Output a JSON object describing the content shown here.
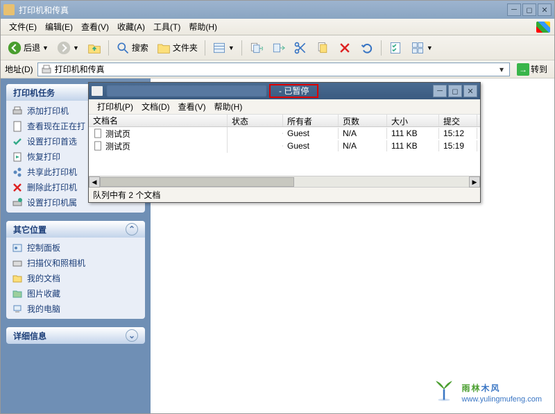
{
  "window": {
    "title": "打印机和传真"
  },
  "menu": {
    "file": "文件(E)",
    "edit": "编辑(E)",
    "view": "查看(V)",
    "favorites": "收藏(A)",
    "tools": "工具(T)",
    "help": "帮助(H)"
  },
  "toolbar": {
    "back": "后退",
    "search": "搜索",
    "folders": "文件夹"
  },
  "address": {
    "label": "地址(D)",
    "value": "打印机和传真",
    "go": "转到"
  },
  "sidebar": {
    "tasks": {
      "title": "打印机任务",
      "items": [
        "添加打印机",
        "查看现在正在打",
        "设置打印首选",
        "恢复打印",
        "共享此打印机",
        "删除此打印机",
        "设置打印机属"
      ]
    },
    "other": {
      "title": "其它位置",
      "items": [
        "控制面板",
        "扫描仪和照相机",
        "我的文档",
        "图片收藏",
        "我的电脑"
      ]
    },
    "details": {
      "title": "详细信息"
    }
  },
  "queue_window": {
    "title_status": "- 已暂停",
    "menu": {
      "printer": "打印机(P)",
      "document": "文档(D)",
      "view": "查看(V)",
      "help": "帮助(H)"
    },
    "columns": {
      "doc": "文档名",
      "status": "状态",
      "owner": "所有者",
      "pages": "页数",
      "size": "大小",
      "submitted": "提交"
    },
    "rows": [
      {
        "doc": "测试页",
        "status": "",
        "owner": "Guest",
        "pages": "N/A",
        "size": "111 KB",
        "submitted": "15:12"
      },
      {
        "doc": "测试页",
        "status": "",
        "owner": "Guest",
        "pages": "N/A",
        "size": "111 KB",
        "submitted": "15:19"
      }
    ],
    "footer": "队列中有 2 个文档"
  },
  "watermark": {
    "text": "雨林木风",
    "url": "www.yulingmufeng.com"
  },
  "icons": {
    "back": "back-icon",
    "forward": "forward-icon",
    "up": "up-icon",
    "search": "search-icon",
    "folders": "folders-icon",
    "views": "views-icon"
  }
}
